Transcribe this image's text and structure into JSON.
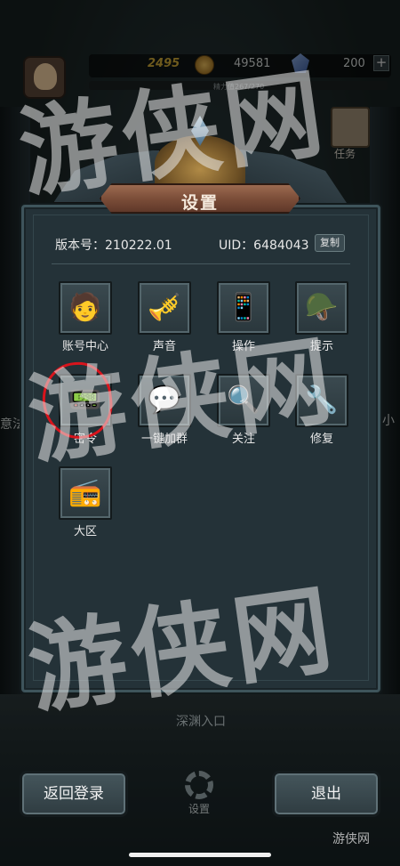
{
  "hud": {
    "gold": "2495",
    "coins": "49581",
    "gems": "200",
    "plus": "+",
    "energy": "精力值267/270",
    "task": "任务"
  },
  "side": {
    "left_text": "意法",
    "right_text": "小"
  },
  "dialog": {
    "title": "设置",
    "version": "版本号：210222.01",
    "uid": "UID：6484043",
    "copy": "复制",
    "items": [
      {
        "label": "账号中心",
        "icon": "account-icon",
        "glyph": "🧑"
      },
      {
        "label": "声音",
        "icon": "gramophone-icon",
        "glyph": "🎺"
      },
      {
        "label": "操作",
        "icon": "phone-touch-icon",
        "glyph": "📱"
      },
      {
        "label": "提示",
        "icon": "helmet-icon",
        "glyph": "🪖"
      },
      {
        "label": "密令",
        "icon": "radio-icon",
        "glyph": "📟"
      },
      {
        "label": "一键加群",
        "icon": "chat-bubble-icon",
        "glyph": "💬"
      },
      {
        "label": "关注",
        "icon": "magnifier-icon",
        "glyph": "🔍"
      },
      {
        "label": "修复",
        "icon": "tools-icon",
        "glyph": "🔧"
      },
      {
        "label": "大区",
        "icon": "radio-set-icon",
        "glyph": "📻"
      }
    ]
  },
  "bottom": {
    "back": "返回登录",
    "exit": "退出",
    "gear_label": "设置",
    "abyss": "深渊入口"
  },
  "watermark": {
    "big": "游侠网",
    "small": "游侠网"
  },
  "colors": {
    "annotation_circle": "#d8141c",
    "gold_text": "#c9a436",
    "title_plate": "#8c5c45"
  }
}
